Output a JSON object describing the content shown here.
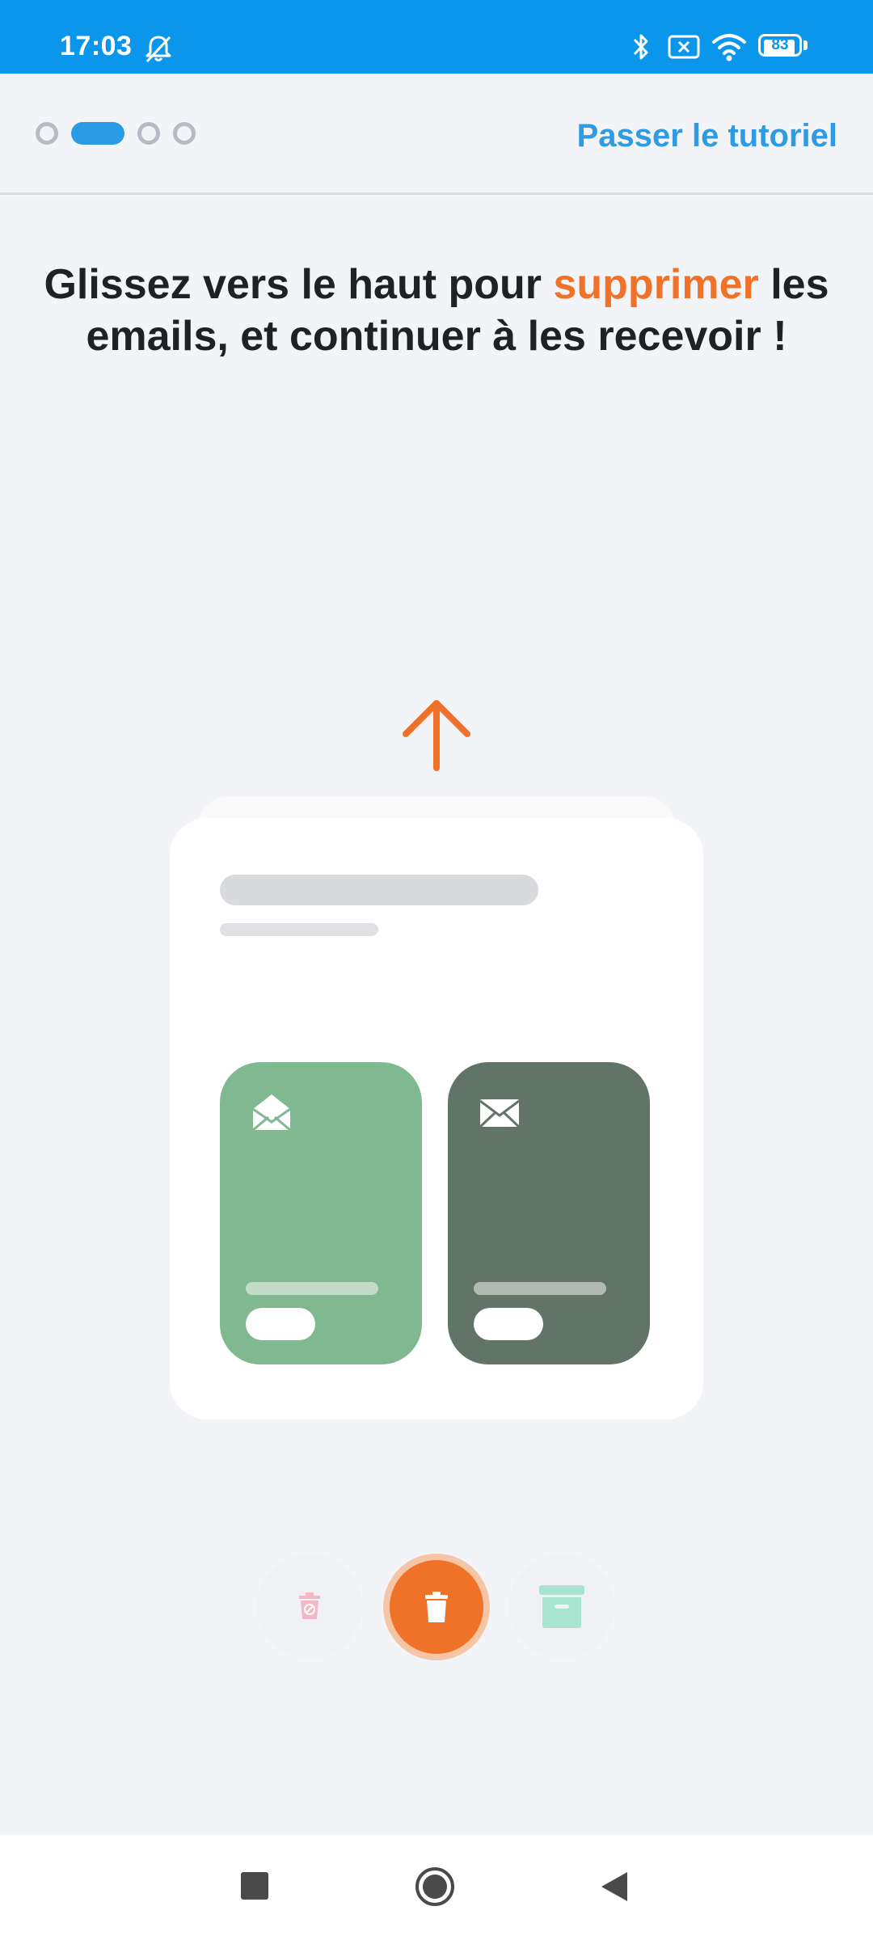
{
  "status_bar": {
    "time": "17:03",
    "battery": "83",
    "battery_level": 0.83,
    "icons": [
      "bell-off-icon",
      "bluetooth-icon",
      "sim-off-icon",
      "wifi-icon",
      "battery-icon"
    ]
  },
  "header": {
    "pager": {
      "count": 4,
      "active_index": 1
    },
    "skip_label": "Passer le tutoriel"
  },
  "headline": {
    "before": "Glissez vers le haut pour ",
    "accent": "supprimer",
    "after": " les emails, et continuer à les recevoir !"
  },
  "illustration": {
    "arrow_icon": "arrow-up-icon",
    "tiles": [
      {
        "icon": "envelope-open-icon",
        "color": "#80b990"
      },
      {
        "icon": "envelope-icon",
        "color": "#627467"
      }
    ]
  },
  "actions": [
    {
      "icon": "unsubscribe-trash-icon",
      "state": "inactive"
    },
    {
      "icon": "trash-icon",
      "state": "active"
    },
    {
      "icon": "archive-icon",
      "state": "inactive"
    }
  ],
  "nav_bar": {
    "icons": [
      "recents-square-icon",
      "home-circle-icon",
      "back-triangle-icon"
    ]
  },
  "colors": {
    "status_bar": "#0a96ea",
    "accent": "#f07228",
    "link": "#2e9be3",
    "background": "#f3f4f8"
  }
}
